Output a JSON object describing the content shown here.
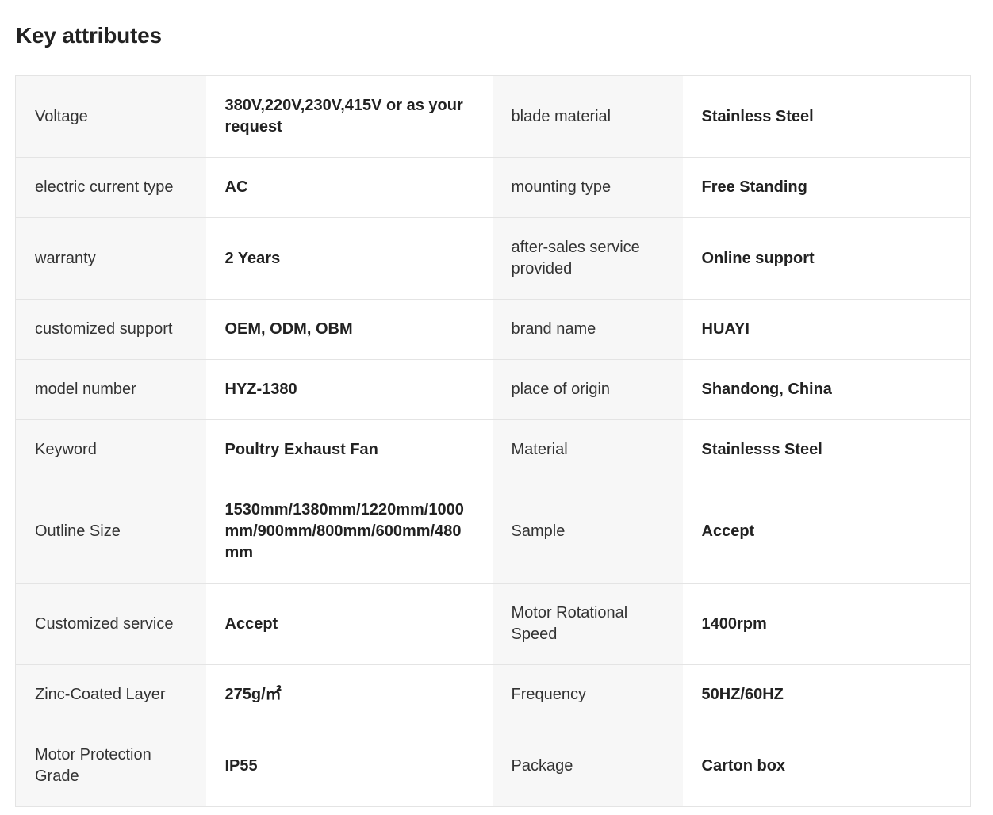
{
  "section": {
    "title": "Key attributes"
  },
  "rows": [
    {
      "label1": "Voltage",
      "value1": "380V,220V,230V,415V or as your request",
      "label2": "blade material",
      "value2": "Stainless Steel"
    },
    {
      "label1": "electric current type",
      "value1": "AC",
      "label2": "mounting type",
      "value2": "Free Standing"
    },
    {
      "label1": "warranty",
      "value1": "2 Years",
      "label2": "after-sales service provided",
      "value2": "Online support"
    },
    {
      "label1": "customized support",
      "value1": "OEM, ODM, OBM",
      "label2": "brand name",
      "value2": "HUAYI"
    },
    {
      "label1": "model number",
      "value1": "HYZ-1380",
      "label2": "place of origin",
      "value2": "Shandong, China"
    },
    {
      "label1": "Keyword",
      "value1": "Poultry Exhaust Fan",
      "label2": "Material",
      "value2": "Stainlesss Steel"
    },
    {
      "label1": "Outline Size",
      "value1": "1530mm/1380mm/1220mm/1000mm/900mm/800mm/600mm/480mm",
      "label2": "Sample",
      "value2": "Accept"
    },
    {
      "label1": "Customized service",
      "value1": "Accept",
      "label2": "Motor Rotational Speed",
      "value2": "1400rpm"
    },
    {
      "label1": "Zinc-Coated Layer",
      "value1": "275g/㎡",
      "label2": "Frequency",
      "value2": "50HZ/60HZ"
    },
    {
      "label1": "Motor Protection Grade",
      "value1": "IP55",
      "label2": "Package",
      "value2": "Carton box"
    }
  ]
}
